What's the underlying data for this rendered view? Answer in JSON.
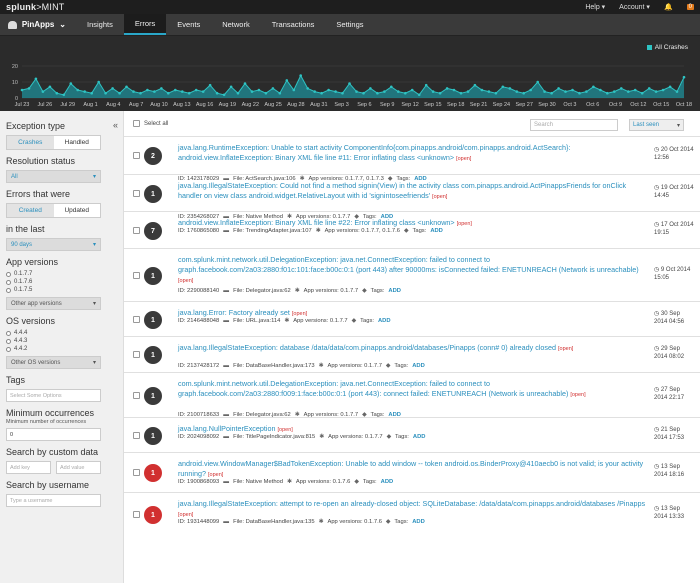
{
  "topbar": {
    "logo_a": "splunk",
    "logo_b": ">MINT",
    "help": "Help ▾",
    "account": "Account ▾",
    "bell": "🔔",
    "notif": "0"
  },
  "nav": {
    "app": "PinApps",
    "tabs": [
      {
        "label": "Insights"
      },
      {
        "label": "Errors"
      },
      {
        "label": "Events"
      },
      {
        "label": "Network"
      },
      {
        "label": "Transactions"
      },
      {
        "label": "Settings"
      }
    ]
  },
  "chart_data": {
    "type": "area",
    "legend": "All Crashes",
    "ylim": [
      0,
      20
    ],
    "yticks": [
      "20",
      "10",
      "0"
    ],
    "grid": true,
    "xlabels": [
      "Jul 23",
      "Jul 26",
      "Jul 29",
      "Aug 1",
      "Aug 4",
      "Aug 7",
      "Aug 10",
      "Aug 13",
      "Aug 16",
      "Aug 19",
      "Aug 22",
      "Aug 25",
      "Aug 28",
      "Aug 31",
      "Sep 3",
      "Sep 6",
      "Sep 9",
      "Sep 12",
      "Sep 15",
      "Sep 18",
      "Sep 21",
      "Sep 24",
      "Sep 27",
      "Sep 30",
      "Oct 3",
      "Oct 6",
      "Oct 9",
      "Oct 12",
      "Oct 15",
      "Oct 18"
    ],
    "values": [
      5,
      6,
      12,
      4,
      7,
      3,
      2,
      9,
      5,
      4,
      3,
      10,
      3,
      6,
      3,
      7,
      4,
      3,
      5,
      4,
      6,
      3,
      5,
      4,
      3,
      5,
      4,
      8,
      3,
      2,
      7,
      3,
      9,
      4,
      5,
      3,
      6,
      3,
      11,
      5,
      14,
      6,
      4,
      3,
      5,
      4,
      3,
      9,
      4,
      3,
      6,
      3,
      4,
      7,
      4,
      3,
      5,
      2,
      8,
      4,
      3,
      6,
      5,
      3,
      4,
      8,
      5,
      4,
      3,
      7,
      6,
      4,
      3,
      5,
      10,
      4,
      3,
      6,
      4,
      5,
      3,
      4,
      7,
      5,
      3,
      4,
      6,
      4,
      5,
      3,
      6,
      4,
      5,
      7,
      4,
      13
    ]
  },
  "sidebar": {
    "collapse": "«",
    "exception_type": {
      "title": "Exception type",
      "opts": [
        "Crashes",
        "Handled"
      ]
    },
    "resolution": {
      "title": "Resolution status",
      "value": "All"
    },
    "errors_were": {
      "title": "Errors that were",
      "opts": [
        "Created",
        "Updated"
      ]
    },
    "in_last": {
      "title": "in the last",
      "value": "90 days"
    },
    "app_versions": {
      "title": "App versions",
      "items": [
        "0.1.7.7",
        "0.1.7.6",
        "0.1.7.5"
      ],
      "other": "Other app versions"
    },
    "os_versions": {
      "title": "OS versions",
      "items": [
        "4.4.4",
        "4.4.3",
        "4.4.2"
      ],
      "other": "Other OS versions"
    },
    "tags": {
      "title": "Tags",
      "placeholder": "Select Some Options"
    },
    "min_occ": {
      "title": "Minimum occurrences",
      "sub": "Minimum number of occurrences",
      "value": "0"
    },
    "custom": {
      "title": "Search by custom data",
      "key": "Add key",
      "val": "Add value"
    },
    "username": {
      "title": "Search by username",
      "placeholder": "Type a username"
    }
  },
  "toolbar": {
    "select_all": "Select all",
    "search_placeholder": "Search",
    "sort": "Last seen"
  },
  "errors": [
    {
      "count": "2",
      "title": "java.lang.RuntimeException: Unable to start activity ComponentInfo{com.pinapps.android/com.pinapps.android.ActSearch}: android.view.InflateException: Binary XML file line #11: Error inflating class <unknown>",
      "id": "ID: 1423178029",
      "file": "File: ActSearch.java:106",
      "app": "App versions: 0.1.7.7, 0.1.7.3",
      "tags": "Tags:",
      "add": "ADD",
      "date": "20 Oct 2014 12:56"
    },
    {
      "count": "1",
      "title": "java.lang.IllegalStateException: Could not find a method signin(View) in the activity class com.pinapps.android.ActPinappsFriends for onClick handler on view class android.widget.RelativeLayout with id 'signintoseefriends'",
      "id": "ID: 2354268027",
      "file": "File: Native Method",
      "app": "App versions: 0.1.7.7",
      "tags": "Tags:",
      "add": "ADD",
      "date": "19 Oct 2014 14:45"
    },
    {
      "count": "7",
      "title": "android.view.InflateException: Binary XML file line #22: Error inflating class <unknown>",
      "id": "ID: 1760865080",
      "file": "File: TrendingAdapter.java:107",
      "app": "App versions: 0.1.7.7, 0.1.7.6",
      "tags": "Tags:",
      "add": "ADD",
      "date": "17 Oct 2014 19:15"
    },
    {
      "count": "1",
      "title": "com.splunk.mint.network.util.DelegationException: java.net.ConnectException: failed to connect to graph.facebook.com/2a03:2880:f01c:101:face:b00c:0:1 (port 443) after 90000ms: isConnected failed: ENETUNREACH (Network is unreachable)",
      "id": "ID: 2290088140",
      "file": "File: Delegator.java:62",
      "app": "App versions: 0.1.7.7",
      "tags": "Tags:",
      "add": "ADD",
      "date": "9 Oct 2014 15:05"
    },
    {
      "count": "1",
      "title": "java.lang.Error: Factory already set",
      "id": "ID: 2146488048",
      "file": "File: URL.java:114",
      "app": "App versions: 0.1.7.7",
      "tags": "Tags:",
      "add": "ADD",
      "date": "30 Sep 2014 04:56"
    },
    {
      "count": "1",
      "title": "java.lang.IllegalStateException: database /data/data/com.pinapps.android/databases/Pinapps (conn# 0) already closed",
      "id": "ID: 2137428172",
      "file": "File: DataBaseHandler.java:173",
      "app": "App versions: 0.1.7.7",
      "tags": "Tags:",
      "add": "ADD",
      "date": "29 Sep 2014 08:02"
    },
    {
      "count": "1",
      "title": "com.splunk.mint.network.util.DelegationException: java.net.ConnectException: failed to connect to graph.facebook.com/2a03:2880:f009:1:face:b00c:0:1 (port 443): connect failed: ENETUNREACH (Network is unreachable)",
      "id": "ID: 2100718633",
      "file": "File: Delegator.java:62",
      "app": "App versions: 0.1.7.7",
      "tags": "Tags:",
      "add": "ADD",
      "date": "27 Sep 2014 22:17"
    },
    {
      "count": "1",
      "title": "java.lang.NullPointerException",
      "id": "ID: 2024098092",
      "file": "File: TitlePageIndicator.java:815",
      "app": "App versions: 0.1.7.7",
      "tags": "Tags:",
      "add": "ADD",
      "date": "21 Sep 2014 17:53"
    },
    {
      "count": "1",
      "red": true,
      "title": "android.view.WindowManager$BadTokenException: Unable to add window -- token android.os.BinderProxy@410aecb0 is not valid; is your activity running?",
      "id": "ID: 1900868093",
      "file": "File: Native Method",
      "app": "App versions: 0.1.7.6",
      "tags": "Tags:",
      "add": "ADD",
      "date": "13 Sep 2014 18:16"
    },
    {
      "count": "1",
      "red": true,
      "title": "java.lang.IllegalStateException: attempt to re-open an already-closed object: SQLiteDatabase: /data/data/com.pinapps.android/databases /Pinapps",
      "id": "ID: 1931448099",
      "file": "File: DataBaseHandler.java:135",
      "app": "App versions: 0.1.7.6",
      "tags": "Tags:",
      "add": "ADD",
      "date": "13 Sep 2014 13:33"
    }
  ],
  "open_label": "[open]"
}
